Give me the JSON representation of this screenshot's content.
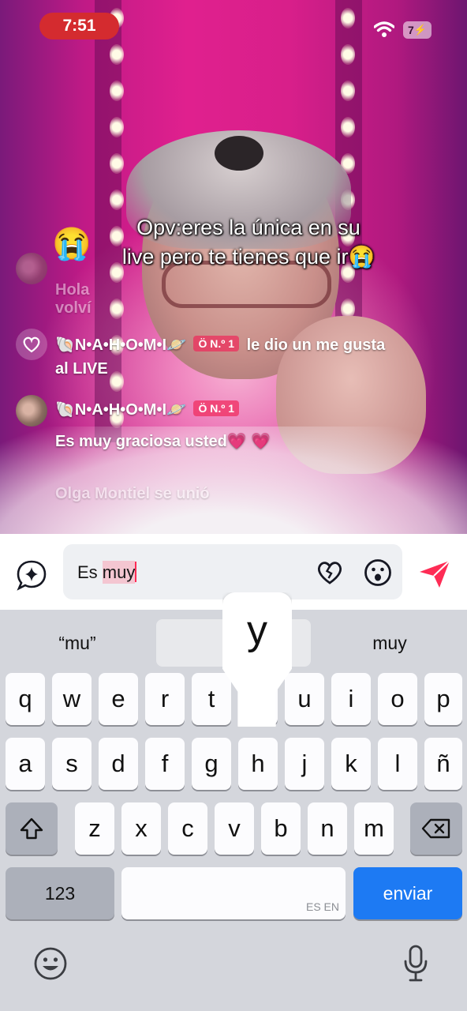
{
  "status_bar": {
    "time": "7:51",
    "battery": "7"
  },
  "caption": {
    "emoji": "😭",
    "line1": "Opv:eres la única en su",
    "line2": "live pero te tienes que ir😭"
  },
  "chat": {
    "faded_message": "Hola volví",
    "like_event": {
      "user": "🐚N•A•H•O•M•I🪐",
      "rank": "Ö N.º 1",
      "text_inline": "le dio un me gusta",
      "text_wrap": "al LIVE"
    },
    "comment": {
      "user": "🐚N•A•H•O•M•I🪐",
      "rank": "Ö N.º 1",
      "text": "Es muy graciosa usted💗 💗"
    },
    "join_event": "Olga Montiel se unió"
  },
  "input": {
    "text_prefix": "Es ",
    "text_marked": "muy"
  },
  "keyboard": {
    "suggestions": [
      "“mu”",
      "",
      "muy"
    ],
    "row1": [
      "q",
      "w",
      "e",
      "r",
      "t",
      "y",
      "u",
      "i",
      "o",
      "p"
    ],
    "row2": [
      "a",
      "s",
      "d",
      "f",
      "g",
      "h",
      "j",
      "k",
      "l",
      "ñ"
    ],
    "row3": [
      "z",
      "x",
      "c",
      "v",
      "b",
      "n",
      "m"
    ],
    "numbers_key": "123",
    "space_languages": "ES EN",
    "return_key": "enviar",
    "popup_letter": "y"
  }
}
